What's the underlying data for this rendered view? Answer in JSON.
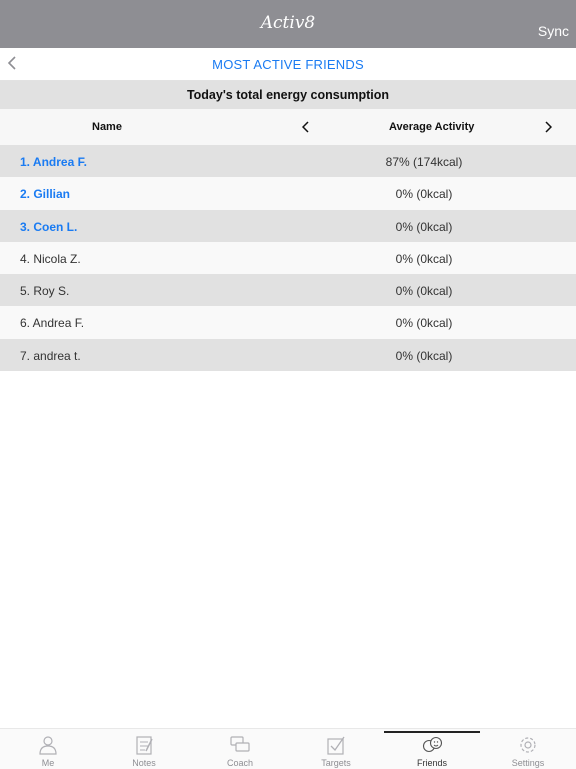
{
  "app": {
    "logo": "Activ8",
    "sync_label": "Sync"
  },
  "nav": {
    "title": "MOST ACTIVE FRIENDS"
  },
  "subheader": "Today's total energy consumption",
  "columns": {
    "name": "Name",
    "metric": "Average Activity",
    "prev": "‹",
    "next": "›"
  },
  "rows": [
    {
      "name": "1. Andrea F.",
      "value": "87% (174kcal)",
      "highlight": true
    },
    {
      "name": "2. Gillian",
      "value": "0% (0kcal)",
      "highlight": true
    },
    {
      "name": "3. Coen L.",
      "value": "0% (0kcal)",
      "highlight": true
    },
    {
      "name": "4. Nicola Z.",
      "value": "0% (0kcal)",
      "highlight": false
    },
    {
      "name": "5. Roy S.",
      "value": "0% (0kcal)",
      "highlight": false
    },
    {
      "name": "6. Andrea F.",
      "value": "0% (0kcal)",
      "highlight": false
    },
    {
      "name": "7. andrea t.",
      "value": "0% (0kcal)",
      "highlight": false
    }
  ],
  "tabs": [
    {
      "label": "Me",
      "icon": "person-icon",
      "active": false
    },
    {
      "label": "Notes",
      "icon": "notepad-icon",
      "active": false
    },
    {
      "label": "Coach",
      "icon": "chat-bubbles-icon",
      "active": false
    },
    {
      "label": "Targets",
      "icon": "checkbox-icon",
      "active": false
    },
    {
      "label": "Friends",
      "icon": "smiley-faces-icon",
      "active": true
    },
    {
      "label": "Settings",
      "icon": "gear-icon",
      "active": false
    }
  ],
  "colors": {
    "accent": "#1a7bf2",
    "topbar": "#8e8e93",
    "row_dark": "#e1e1e1",
    "row_light": "#f9f9f9"
  }
}
